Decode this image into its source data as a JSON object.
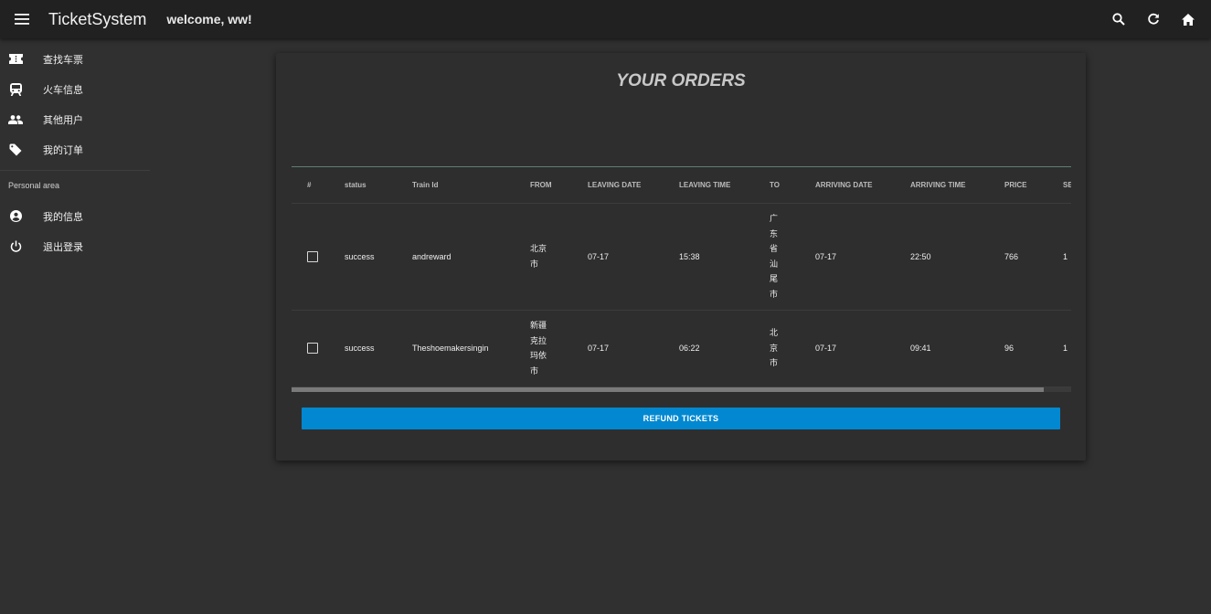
{
  "appbar": {
    "title": "TicketSystem",
    "welcome": "welcome, ww!",
    "icons": [
      "menu-icon",
      "search-icon",
      "refresh-icon",
      "home-icon"
    ]
  },
  "drawer": {
    "items": [
      {
        "label": "查找车票",
        "icon": "ticket-icon"
      },
      {
        "label": "火车信息",
        "icon": "train-icon"
      },
      {
        "label": "其他用户",
        "icon": "people-icon"
      },
      {
        "label": "我的订单",
        "icon": "tag-icon"
      }
    ],
    "section_title": "Personal area",
    "personal_items": [
      {
        "label": "我的信息",
        "icon": "account-circle-icon"
      },
      {
        "label": "退出登录",
        "icon": "power-icon"
      }
    ]
  },
  "orders": {
    "title": "YOUR ORDERS",
    "columns": [
      "#",
      "status",
      "Train Id",
      "FROM",
      "LEAVING DATE",
      "LEAVING TIME",
      "TO",
      "ARRIVING DATE",
      "ARRIVING TIME",
      "PRICE",
      "SE"
    ],
    "rows": [
      {
        "status": "success",
        "train_id": "andreward",
        "from": [
          "北京",
          "市"
        ],
        "leaving_date": "07-17",
        "leaving_time": "15:38",
        "to": [
          "广",
          "东",
          "省",
          "汕",
          "尾",
          "市"
        ],
        "arriving_date": "07-17",
        "arriving_time": "22:50",
        "price": "766",
        "seat": "1"
      },
      {
        "status": "success",
        "train_id": "Theshoemakersingin",
        "from": [
          "新疆",
          "克拉",
          "玛依",
          "市"
        ],
        "leaving_date": "07-17",
        "leaving_time": "06:22",
        "to": [
          "北",
          "京",
          "市"
        ],
        "arriving_date": "07-17",
        "arriving_time": "09:41",
        "price": "96",
        "seat": "1"
      }
    ],
    "refund_label": "REFUND TICKETS"
  },
  "colors": {
    "appbar": "#212121",
    "background": "#303030",
    "card": "#2e2e2e",
    "accent": "#0288d1"
  }
}
